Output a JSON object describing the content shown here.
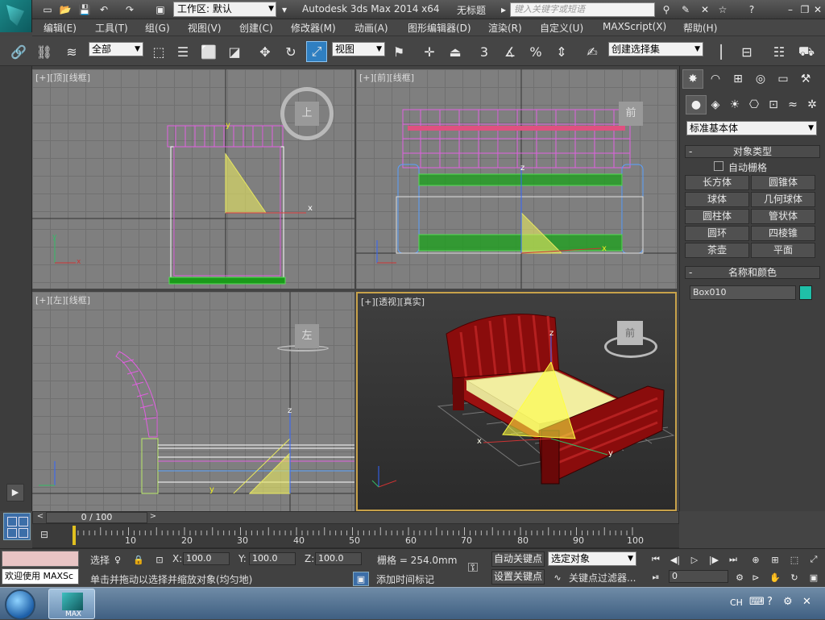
{
  "titlebar": {
    "workspace_label": "工作区: 默认",
    "app_title": "Autodesk 3ds Max  2014 x64",
    "document_title": "无标题",
    "search_placeholder": "键入关键字或短语"
  },
  "menu": {
    "items": [
      "编辑(E)",
      "工具(T)",
      "组(G)",
      "视图(V)",
      "创建(C)",
      "修改器(M)",
      "动画(A)",
      "图形编辑器(D)",
      "渲染(R)",
      "自定义(U)",
      "MAXScript(X)",
      "帮助(H)"
    ]
  },
  "toolbar": {
    "filter_value": "全部",
    "coord_value": "视图",
    "snap_label": "3",
    "percent_label": "%",
    "selection_set_placeholder": "创建选择集"
  },
  "viewports": {
    "top": {
      "label_plus": "[+]",
      "label_view": "[顶]",
      "label_shade": "[线框]",
      "cube_face": "上"
    },
    "front": {
      "label_plus": "[+]",
      "label_view": "[前]",
      "label_shade": "[线框]",
      "cube_face": "前"
    },
    "left": {
      "label_plus": "[+]",
      "label_view": "[左]",
      "label_shade": "[线框]",
      "cube_face": "左"
    },
    "persp": {
      "label_plus": "[+]",
      "label_view": "[透视]",
      "label_shade": "[真实]",
      "cube_face": "前"
    }
  },
  "command_panel": {
    "category_value": "标准基本体",
    "object_type_title": "对象类型",
    "autogrid_label": "自动栅格",
    "buttons": [
      "长方体",
      "圆锥体",
      "球体",
      "几何球体",
      "圆柱体",
      "管状体",
      "圆环",
      "四棱锥",
      "茶壶",
      "平面"
    ],
    "name_color_title": "名称和颜色",
    "object_name": "Box010",
    "object_color": "#1fbfa8"
  },
  "timeline": {
    "frame_indicator": "0 / 100",
    "ticks": [
      "10",
      "20",
      "30",
      "40",
      "50",
      "60",
      "70",
      "80",
      "90",
      "100"
    ],
    "progress": 0
  },
  "status": {
    "maxscript_label": "欢迎使用 MAXSc",
    "select_label": "选择",
    "x_label": "X:",
    "x_value": "100.0",
    "y_label": "Y:",
    "y_value": "100.0",
    "z_label": "Z:",
    "z_value": "100.0",
    "grid_label": "栅格 = 254.0mm",
    "prompt_text": "单击并拖动以选择并缩放对象(均匀地)",
    "add_time_tag": "添加时间标记",
    "auto_key": "自动关键点",
    "set_key": "设置关键点",
    "selected_object": "选定对象",
    "key_filters": "关键点过滤器...",
    "frame_value": "0"
  },
  "taskbar": {
    "lang": "CH",
    "app_label": "MAX"
  }
}
